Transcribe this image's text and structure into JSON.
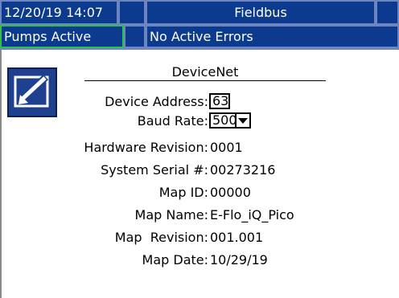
{
  "header": {
    "datetime": "12/20/19 14:07",
    "screen_name": "Fieldbus",
    "status": "Pumps Active",
    "errors": "No Active Errors"
  },
  "panel": {
    "title": "DeviceNet",
    "edit_icon": "edit-icon"
  },
  "fields": {
    "device_address": {
      "label": "Device Address:",
      "value": "63"
    },
    "baud_rate": {
      "label": "Baud Rate:",
      "value": "500"
    },
    "hardware_revision": {
      "label": "Hardware Revision:",
      "value": "0001"
    },
    "system_serial": {
      "label": "System Serial #:",
      "value": "00273216"
    },
    "map_id": {
      "label": "Map ID:",
      "value": "00000"
    },
    "map_name": {
      "label": "Map Name:",
      "value": "E-Flo_iQ_Pico"
    },
    "map_revision": {
      "label": "Map  Revision:",
      "value": "001.001"
    },
    "map_date": {
      "label": "Map Date:",
      "value": "10/29/19"
    }
  },
  "colors": {
    "bar_background": "#0b3a8f",
    "cell_border": "#6e86c0",
    "active_border": "#2fc04a"
  }
}
